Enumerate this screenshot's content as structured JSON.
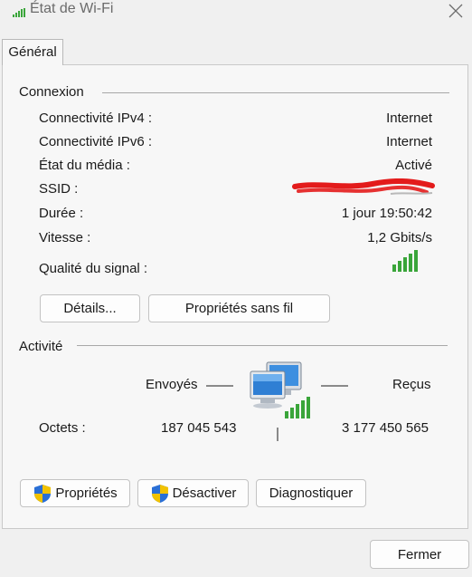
{
  "window": {
    "title": "État de Wi-Fi"
  },
  "tabs": [
    {
      "label": "Général"
    }
  ],
  "connection": {
    "heading": "Connexion",
    "rows": [
      {
        "label": "Connectivité IPv4 :",
        "value": "Internet"
      },
      {
        "label": "Connectivité IPv6 :",
        "value": "Internet"
      },
      {
        "label": "État du média :",
        "value": "Activé"
      },
      {
        "label": "SSID :",
        "value": ""
      },
      {
        "label": "Durée :",
        "value": "1 jour 19:50:42"
      },
      {
        "label": "Vitesse :",
        "value": "1,2 Gbits/s"
      }
    ],
    "signal_label": "Qualité du signal :",
    "signal_bars": 5,
    "details_button": "Détails...",
    "wireless_props_button": "Propriétés sans fil"
  },
  "activity": {
    "heading": "Activité",
    "sent_label": "Envoyés",
    "received_label": "Reçus",
    "bytes_label": "Octets :",
    "bytes_sent": "187 045 543",
    "bytes_received": "3 177 450 565"
  },
  "actions": {
    "properties_button": "Propriétés",
    "disable_button": "Désactiver",
    "diagnose_button": "Diagnostiquer"
  },
  "footer": {
    "close_button": "Fermer"
  },
  "colors": {
    "signal_green": "#3aa53a",
    "redaction_red": "#e31b1b",
    "shield_blue": "#2a6fd6",
    "shield_yellow": "#f2c200"
  },
  "icons": [
    "wifi-signal-icon",
    "close-icon",
    "network-computers-icon",
    "uac-shield-icon"
  ]
}
